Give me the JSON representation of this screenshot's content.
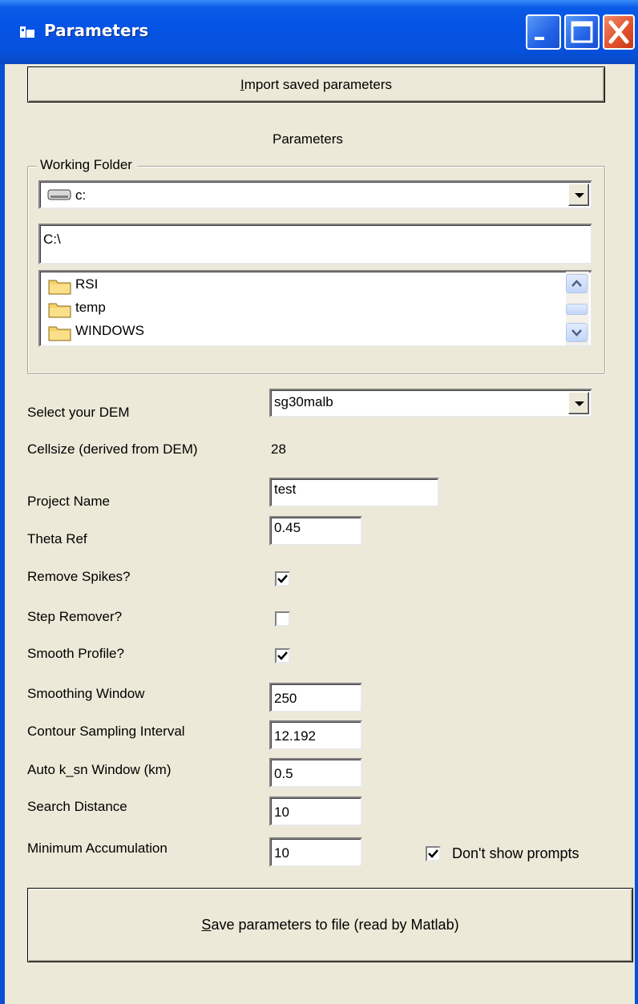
{
  "window": {
    "title": "Parameters"
  },
  "import_button": {
    "label_u": "I",
    "label_rest": "mport saved parameters"
  },
  "section_heading": "Parameters",
  "working_folder": {
    "legend": "Working Folder",
    "drive_value": "c:",
    "path_value": "C:\\",
    "folders": [
      {
        "name": "RSI"
      },
      {
        "name": "temp"
      },
      {
        "name": "WINDOWS"
      }
    ]
  },
  "fields": {
    "dem": {
      "label": "Select your DEM",
      "value": "sg30malb"
    },
    "cellsize": {
      "label": "Cellsize (derived from DEM)",
      "value": "28"
    },
    "project_name": {
      "label": "Project Name",
      "value": "test"
    },
    "theta_ref": {
      "label": "Theta Ref",
      "value": "0.45"
    },
    "remove_spikes": {
      "label": "Remove Spikes?",
      "checked": true
    },
    "step_remover": {
      "label": "Step Remover?",
      "checked": false
    },
    "smooth_profile": {
      "label": "Smooth Profile?",
      "checked": true
    },
    "smoothing_window": {
      "label": "Smoothing Window",
      "value": "250"
    },
    "contour_interval": {
      "label": "Contour Sampling Interval",
      "value": "12.192"
    },
    "ksn_window": {
      "label": "Auto k_sn Window (km)",
      "value": "0.5"
    },
    "search_distance": {
      "label": "Search Distance",
      "value": "10"
    },
    "min_accumulation": {
      "label": "Minimum Accumulation",
      "value": "10"
    }
  },
  "dont_show_prompts": {
    "label": "Don't show prompts",
    "checked": true
  },
  "save_button": {
    "label_u": "S",
    "label_rest": "ave parameters to file (read by Matlab)"
  }
}
